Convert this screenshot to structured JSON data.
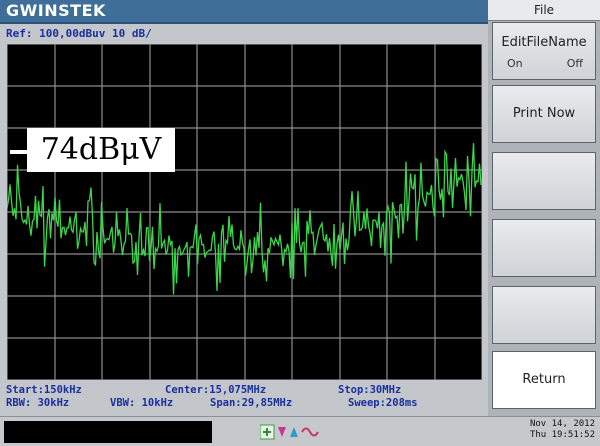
{
  "brand": "GWINSTEK",
  "ref_line": "Ref: 100,00dBuv 10 dB/",
  "marker_label": "74dBμV",
  "footer": {
    "start": "Start:150kHz",
    "rbw": "RBW: 30kHz",
    "vbw": "VBW: 10kHz",
    "center": "Center:15,075MHz",
    "span": "Span:29,85MHz",
    "stop": "Stop:30MHz",
    "sweep": "Sweep:208ms"
  },
  "side_menu": {
    "title": "File",
    "edit_file_name": "EditFileName",
    "on": "On",
    "off": "Off",
    "print_now": "Print Now",
    "return": "Return"
  },
  "status": {
    "date": "Nov 14, 2012",
    "time": "Thu 19:51:52"
  },
  "colors": {
    "trace": "#3bd64a",
    "grid": "#8d8d8d",
    "topbar": "#3f6e99",
    "text_blue": "#1b2f9e"
  },
  "icons": [
    "status-icons"
  ]
}
